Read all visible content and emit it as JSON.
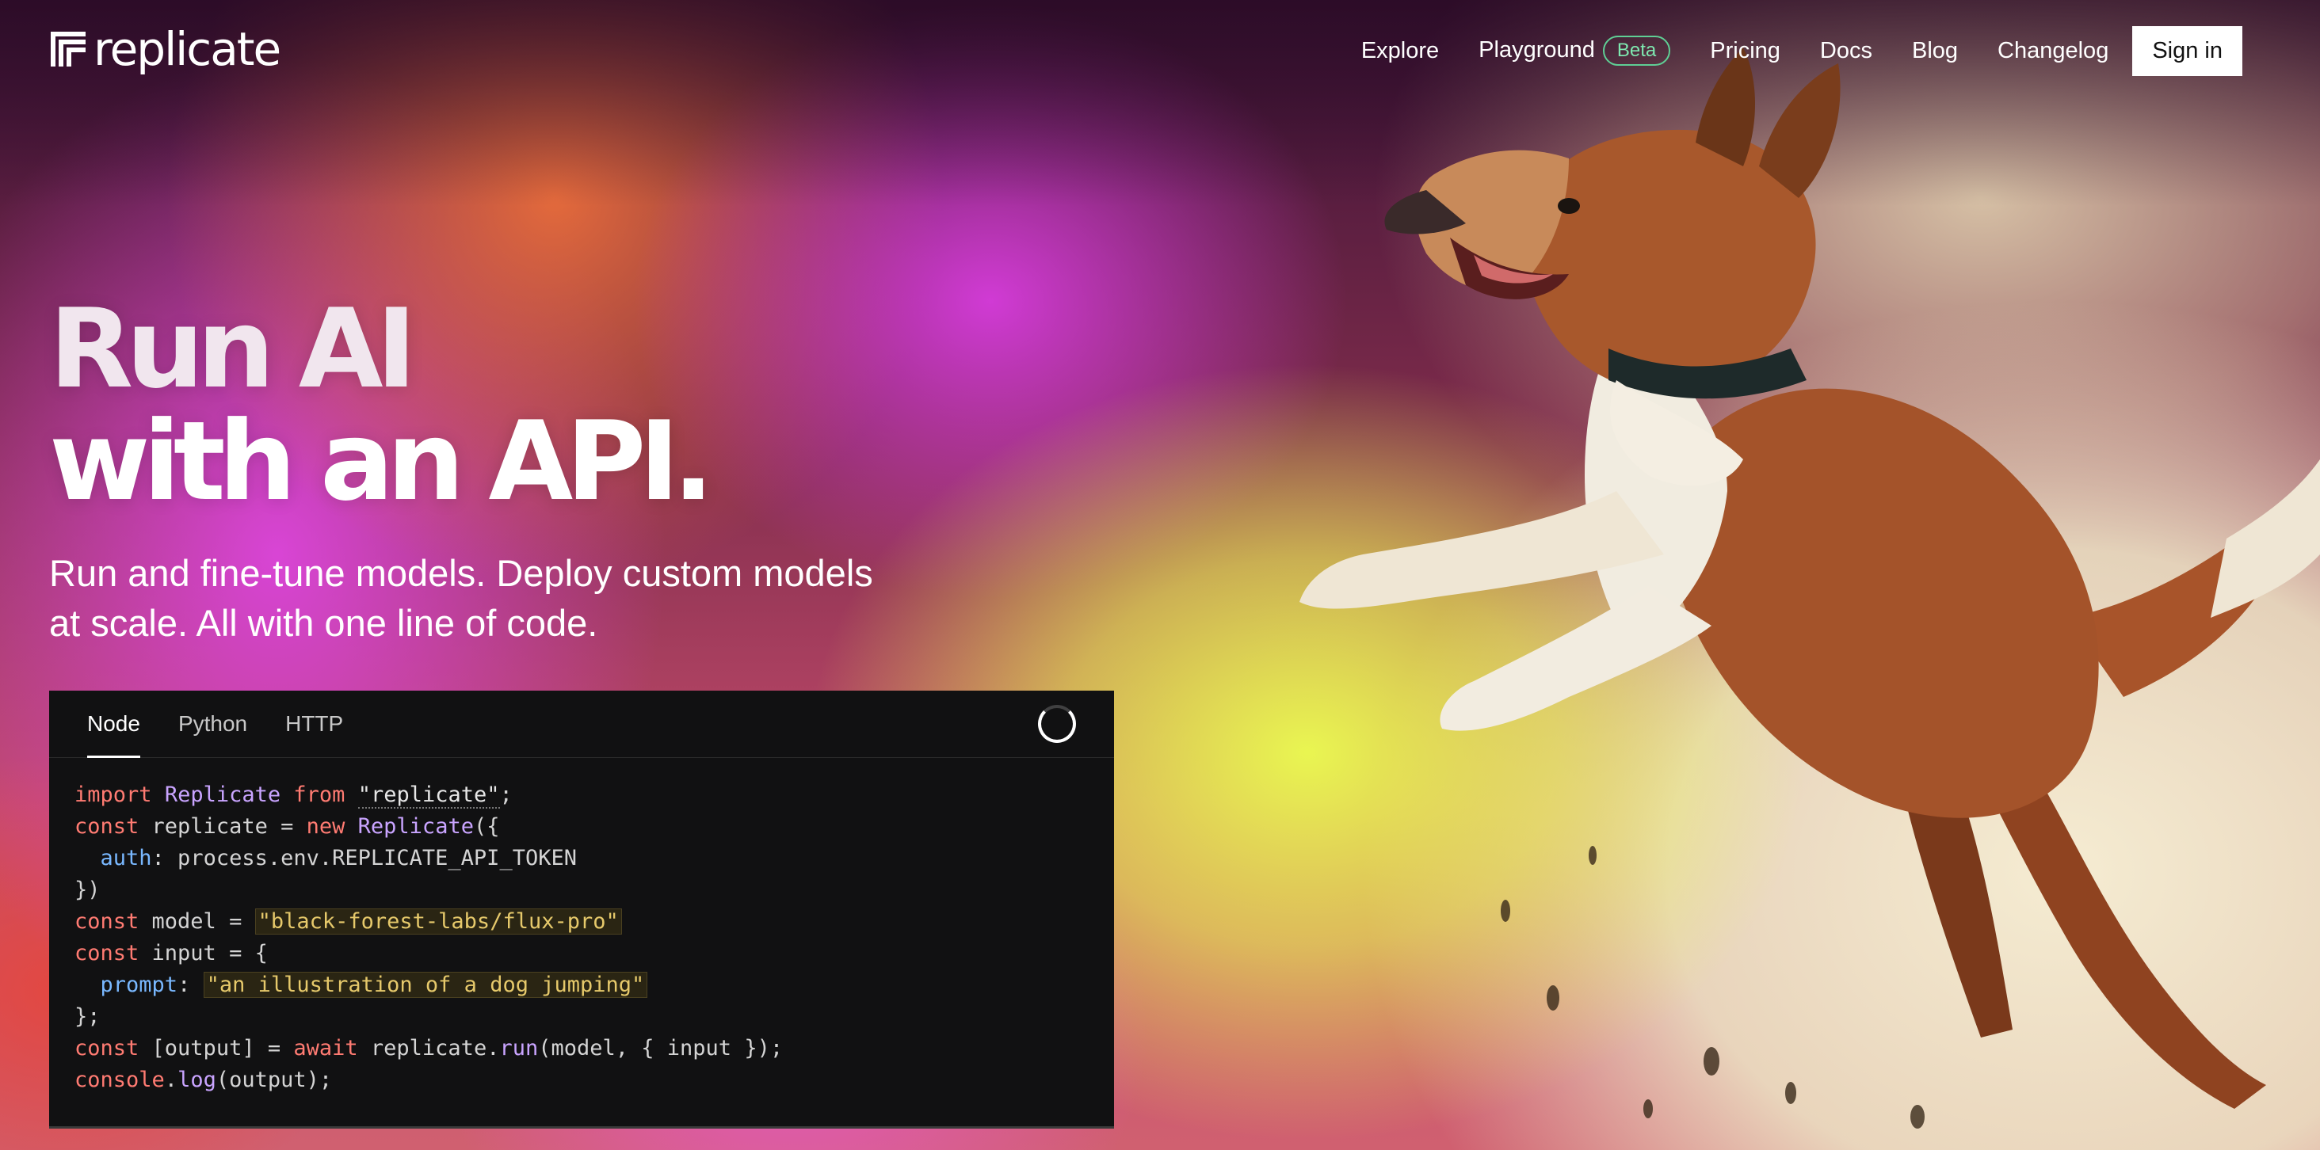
{
  "brand": {
    "name": "replicate"
  },
  "nav": {
    "links": [
      "Explore",
      "Playground",
      "Pricing",
      "Docs",
      "Blog",
      "Changelog"
    ],
    "beta_badge": "Beta",
    "signin_label": "Sign in"
  },
  "hero": {
    "title_line1": "Run AI",
    "title_line2": "with an API.",
    "subtitle": "Run and fine-tune models. Deploy custom models at scale. All with one line of code."
  },
  "code_panel": {
    "tabs": [
      "Node",
      "Python",
      "HTTP"
    ],
    "active_tab": "Node",
    "code": {
      "import_kw": "import",
      "import_name": "Replicate",
      "from_kw": "from",
      "module": "\"replicate\"",
      "semi": ";",
      "const": "const",
      "replicate_var": " replicate = ",
      "new_kw": "new",
      "replicate_cls": "Replicate",
      "open": "({",
      "auth_key": "auth",
      "auth_val": ": process.env.REPLICATE_API_TOKEN",
      "close": "})",
      "model_var": " model = ",
      "model_str": "\"black-forest-labs/flux-pro\"",
      "input_var": " input = {",
      "prompt_key": "prompt",
      "prompt_colon": ": ",
      "prompt_str": "\"an illustration of a dog jumping\"",
      "input_close": "};",
      "output_var": " [output] = ",
      "await_kw": "await",
      "run_pre": " replicate.",
      "run_fn": "run",
      "run_args": "(model, { input });",
      "console_obj": "console",
      "log_dot": ".",
      "log_fn": "log",
      "log_args": "(output);"
    }
  },
  "colors": {
    "accent_beta": "#5fcf95",
    "code_bg": "#111112",
    "keyword": "#ff7b72",
    "string": "#e6c96b"
  },
  "icons": {
    "logo": "replicate-logo-icon",
    "loading": "loading-spinner-icon"
  }
}
